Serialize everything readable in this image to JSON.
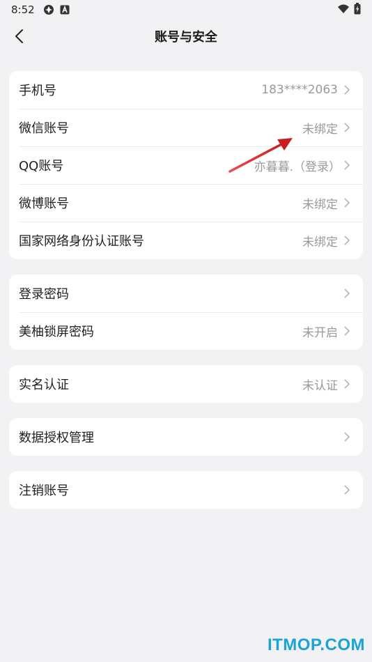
{
  "status_bar": {
    "time": "8:52"
  },
  "header": {
    "title": "账号与安全"
  },
  "groups": [
    {
      "rows": [
        {
          "label": "手机号",
          "value": "183****2063"
        },
        {
          "label": "微信账号",
          "value": "未绑定"
        },
        {
          "label": "QQ账号",
          "value": "亦暮暮.（登录）"
        },
        {
          "label": "微博账号",
          "value": "未绑定"
        },
        {
          "label": "国家网络身份认证账号",
          "value": "未绑定"
        }
      ]
    },
    {
      "rows": [
        {
          "label": "登录密码",
          "value": ""
        },
        {
          "label": "美柚锁屏密码",
          "value": "未开启"
        }
      ]
    },
    {
      "rows": [
        {
          "label": "实名认证",
          "value": "未认证"
        }
      ]
    },
    {
      "rows": [
        {
          "label": "数据授权管理",
          "value": ""
        }
      ]
    },
    {
      "rows": [
        {
          "label": "注销账号",
          "value": ""
        }
      ]
    }
  ],
  "watermark": {
    "text": "ITMOP.COM"
  },
  "colors": {
    "background": "#f2f2f4",
    "card": "#ffffff",
    "value_text": "#9a9a9a",
    "annotation_arrow": "#d8262b",
    "watermark": "#1aa3d8"
  }
}
